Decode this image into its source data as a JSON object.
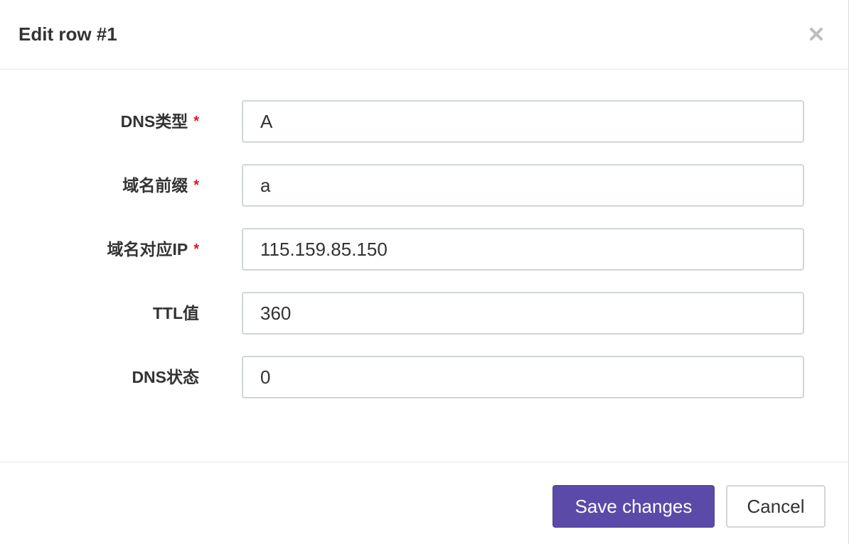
{
  "modal": {
    "title": "Edit row #1"
  },
  "form": {
    "required_mark": "*",
    "fields": [
      {
        "label": "DNS类型",
        "value": "A",
        "required": true
      },
      {
        "label": "域名前缀",
        "value": "a",
        "required": true
      },
      {
        "label": "域名对应IP",
        "value": "115.159.85.150",
        "required": true
      },
      {
        "label": "TTL值",
        "value": "360",
        "required": false
      },
      {
        "label": "DNS状态",
        "value": "0",
        "required": false
      }
    ]
  },
  "footer": {
    "save_label": "Save changes",
    "cancel_label": "Cancel"
  },
  "colors": {
    "primary": "#5c4aa8",
    "required": "#e0161b",
    "border": "#cfd6d6"
  },
  "icons": {
    "close": "close-icon"
  }
}
